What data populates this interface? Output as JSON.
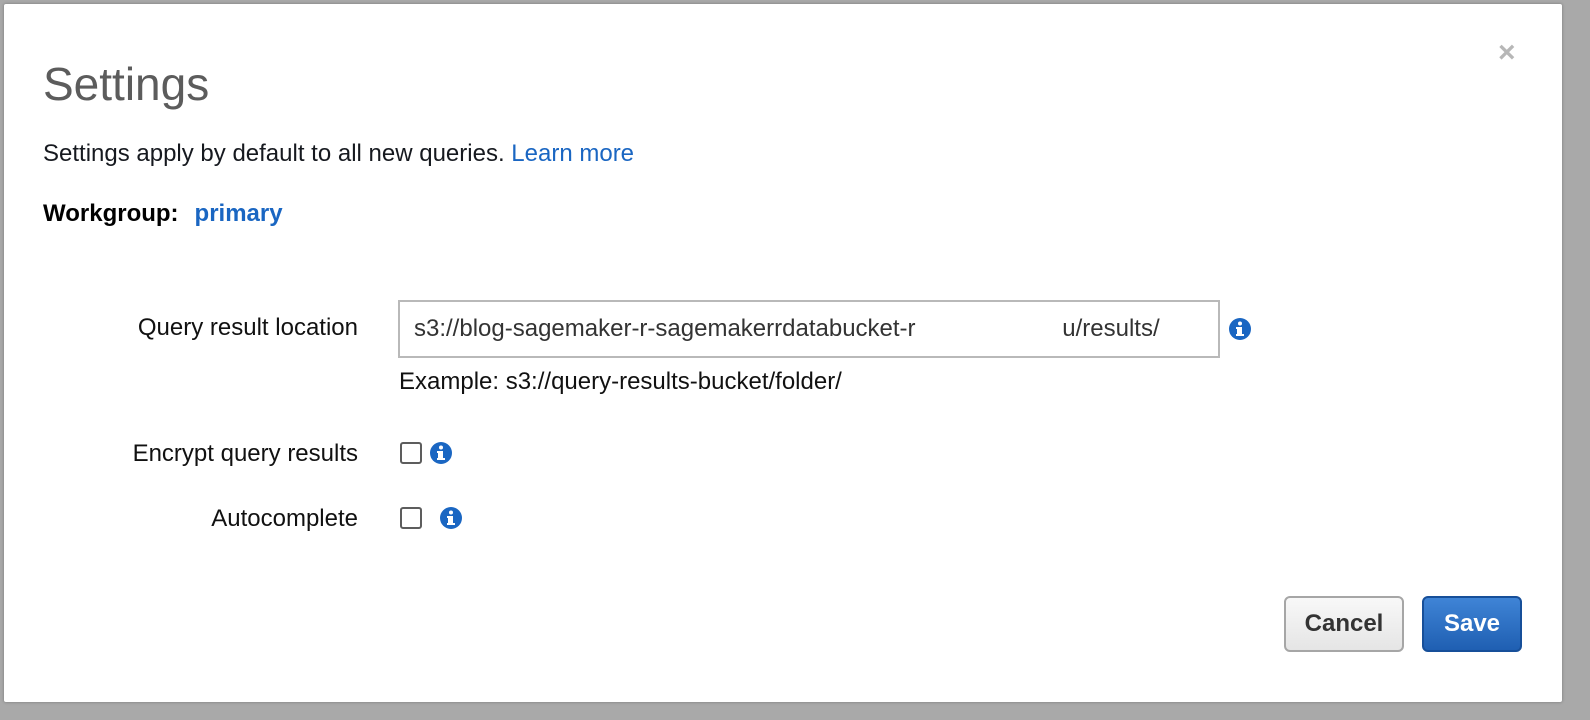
{
  "dialog": {
    "title": "Settings",
    "close_glyph": "×",
    "description": "Settings apply by default to all new queries.",
    "learn_more_link": "Learn more"
  },
  "workgroup": {
    "label": "Workgroup:",
    "value": "primary"
  },
  "form": {
    "query_result_location": {
      "label": "Query result location",
      "value": "s3://blog-sagemaker-r-sagemakerrdatabucket-r                      u/results/",
      "example": "Example: s3://query-results-bucket/folder/",
      "info_icon": "info-icon"
    },
    "encrypt_query_results": {
      "label": "Encrypt query results",
      "checked": false,
      "info_icon": "info-icon"
    },
    "autocomplete": {
      "label": "Autocomplete",
      "checked": false,
      "info_icon": "info-icon"
    }
  },
  "buttons": {
    "cancel_label": "Cancel",
    "save_label": "Save"
  },
  "colors": {
    "link": "#1a66c2",
    "primary_button": "#2566bf",
    "info_icon": "#1a66c2",
    "title": "#5c5c5c"
  }
}
